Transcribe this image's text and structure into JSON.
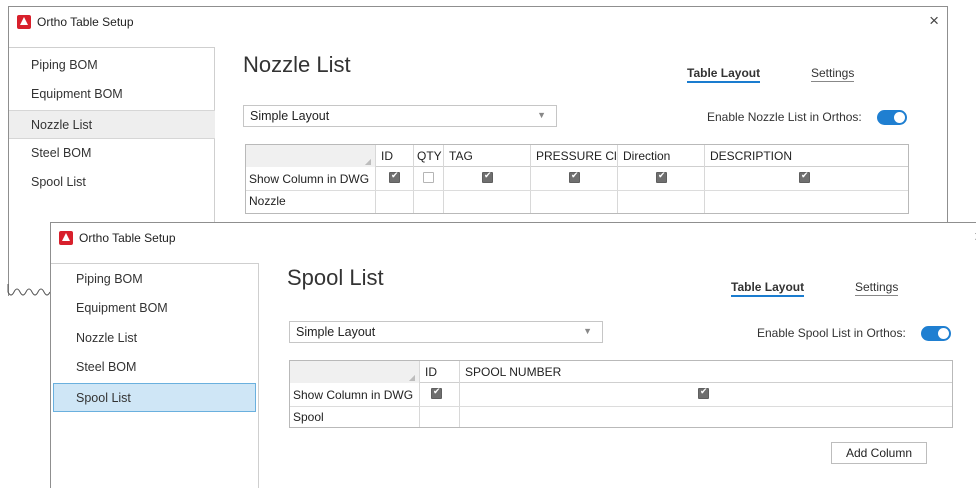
{
  "back_window": {
    "title": "Ortho Table Setup",
    "close_glyph": "×",
    "sidebar": [
      "Piping BOM",
      "Equipment BOM",
      "Nozzle List",
      "Steel BOM",
      "Spool List"
    ],
    "heading": "Nozzle List",
    "tabs": [
      "Table Layout",
      "Settings"
    ],
    "layout_select": "Simple Layout",
    "enable": {
      "prefix": "Enable",
      "name": "Nozzle List",
      "suffix": "in Orthos:",
      "on": true
    },
    "grid": {
      "columns": [
        "ID",
        "QTY",
        "TAG",
        "PRESSURE Cl",
        "Direction",
        "DESCRIPTION"
      ],
      "rows": [
        {
          "label": "Show Column in DWG",
          "checks": [
            true,
            false,
            true,
            true,
            true,
            true
          ]
        },
        {
          "label": "Nozzle"
        }
      ]
    }
  },
  "front_window": {
    "title": "Ortho Table Setup",
    "close_glyph": "×",
    "sidebar": [
      "Piping BOM",
      "Equipment BOM",
      "Nozzle List",
      "Steel BOM",
      "Spool List"
    ],
    "heading": "Spool List",
    "tabs": [
      "Table Layout",
      "Settings"
    ],
    "layout_select": "Simple Layout",
    "enable": {
      "prefix": "Enable",
      "name": "Spool List",
      "suffix": "in Orthos:",
      "on": true
    },
    "grid": {
      "columns": [
        "ID",
        "SPOOL NUMBER"
      ],
      "rows": [
        {
          "label": "Show Column in DWG",
          "checks": [
            true,
            true
          ]
        },
        {
          "label": "Spool"
        }
      ]
    },
    "add_column_button": "Add Column"
  },
  "colors": {
    "accent": "#1f7fd1",
    "selected_item_bg": "#cfe6f6",
    "app_icon": "#d8202c"
  },
  "icons": {
    "app": "autocad-logo-icon",
    "close": "close-icon",
    "dropdown": "chevron-down-icon",
    "corner": "resize-corner-icon",
    "check": "checkmark-icon"
  }
}
